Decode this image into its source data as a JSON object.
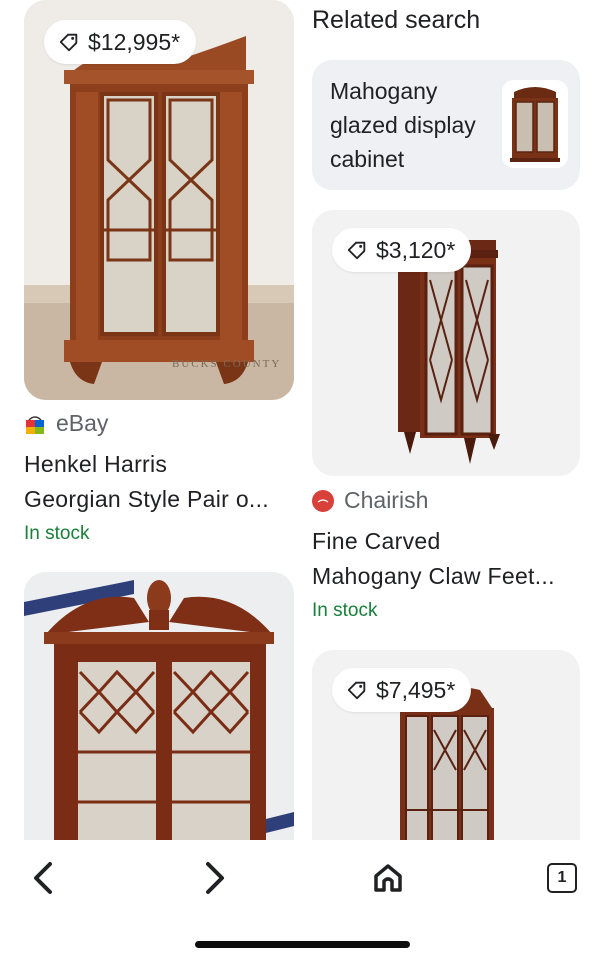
{
  "results_left": [
    {
      "price": "$12,995*",
      "source": "eBay",
      "title_line1": "Henkel Harris",
      "title_line2": "Georgian Style Pair o...",
      "stock": "In stock",
      "watermark": "BUCKS COUNTY"
    },
    {
      "price": "",
      "source": "",
      "title_line1": "",
      "title_line2": "",
      "stock": ""
    }
  ],
  "related": {
    "heading": "Related search",
    "card_label": "Mahogany glazed display cabinet"
  },
  "results_right": [
    {
      "price": "$3,120*",
      "source": "Chairish",
      "title_line1": "Fine Carved",
      "title_line2": "Mahogany Claw Feet...",
      "stock": "In stock"
    },
    {
      "price": "$7,495*"
    }
  ],
  "nav": {
    "back_icon": "chevron-left-icon",
    "forward_icon": "chevron-right-icon",
    "home_icon": "home-icon",
    "tabs_count": "1"
  },
  "colors": {
    "stock_green": "#188038",
    "wood": "#8a3f1e",
    "related_bg": "#eef0f3"
  }
}
